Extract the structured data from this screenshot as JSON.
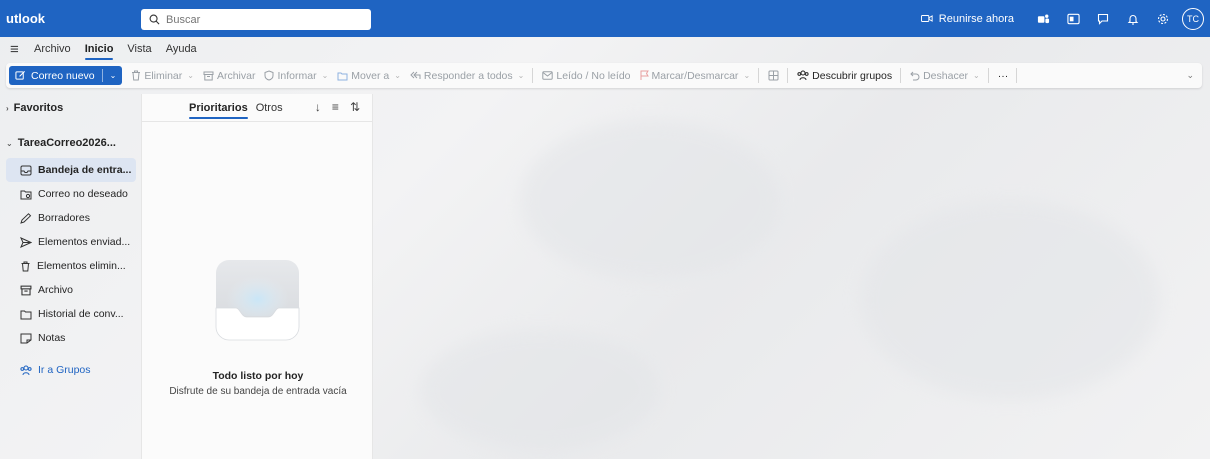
{
  "app": {
    "brand": "utlook"
  },
  "search": {
    "placeholder": "Buscar"
  },
  "topbar": {
    "meet_label": "Reunirse ahora",
    "avatar_initials": "TC"
  },
  "menu": {
    "tabs": [
      "Archivo",
      "Inicio",
      "Vista",
      "Ayuda"
    ],
    "active_tab": "Inicio"
  },
  "ribbon": {
    "new_mail": "Correo nuevo",
    "delete": "Eliminar",
    "archive": "Archivar",
    "report": "Informar",
    "move": "Mover a",
    "reply_all": "Responder a todos",
    "read_unread": "Leído / No leído",
    "flag": "Marcar/Desmarcar",
    "discover_groups": "Descubrir grupos",
    "undo": "Deshacer",
    "more": "···"
  },
  "nav": {
    "favorites": "Favoritos",
    "account": "TareaCorreo2026...",
    "folders": [
      {
        "label": "Bandeja de entra...",
        "icon": "inbox-icon"
      },
      {
        "label": "Correo no deseado",
        "icon": "junk-icon"
      },
      {
        "label": "Borradores",
        "icon": "draft-pencil-icon"
      },
      {
        "label": "Elementos enviad...",
        "icon": "send-icon"
      },
      {
        "label": "Elementos elimin...",
        "icon": "trash-icon"
      },
      {
        "label": "Archivo",
        "icon": "archive-icon"
      },
      {
        "label": "Historial de conv...",
        "icon": "folder-icon"
      },
      {
        "label": "Notas",
        "icon": "note-icon"
      }
    ],
    "groups_link": "Ir a Grupos"
  },
  "list": {
    "tab_focused": "Prioritarios",
    "tab_other": "Otros",
    "empty_title": "Todo listo por hoy",
    "empty_subtitle": "Disfrute de su bandeja de entrada vacía"
  },
  "colors": {
    "brand_blue": "#1f64c2",
    "selected_bg": "#dde5f2"
  }
}
